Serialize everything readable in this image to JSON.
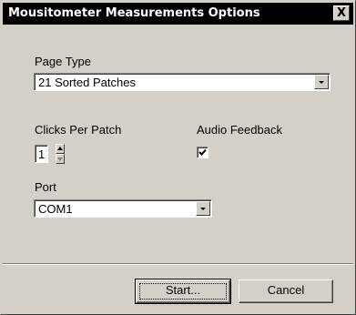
{
  "window": {
    "title": "Mousitometer Measurements Options",
    "close_symbol": "X"
  },
  "page_type": {
    "label": "Page Type",
    "selected": "21 Sorted Patches"
  },
  "clicks_per_patch": {
    "label": "Clicks Per Patch",
    "value": "1"
  },
  "audio_feedback": {
    "label": "Audio Feedback",
    "checked": true
  },
  "port": {
    "label": "Port",
    "selected": "COM1"
  },
  "buttons": {
    "start_label": "Start...",
    "cancel_label": "Cancel"
  },
  "colors": {
    "dialog_face": "#d4d0c8",
    "titlebar": "#000000",
    "title_text": "#ffffff"
  },
  "icons": {
    "close": "close-icon",
    "dropdown": "chevron-down-icon",
    "spin_up": "arrow-up-icon",
    "spin_down": "arrow-down-icon",
    "check": "checkmark-icon"
  }
}
